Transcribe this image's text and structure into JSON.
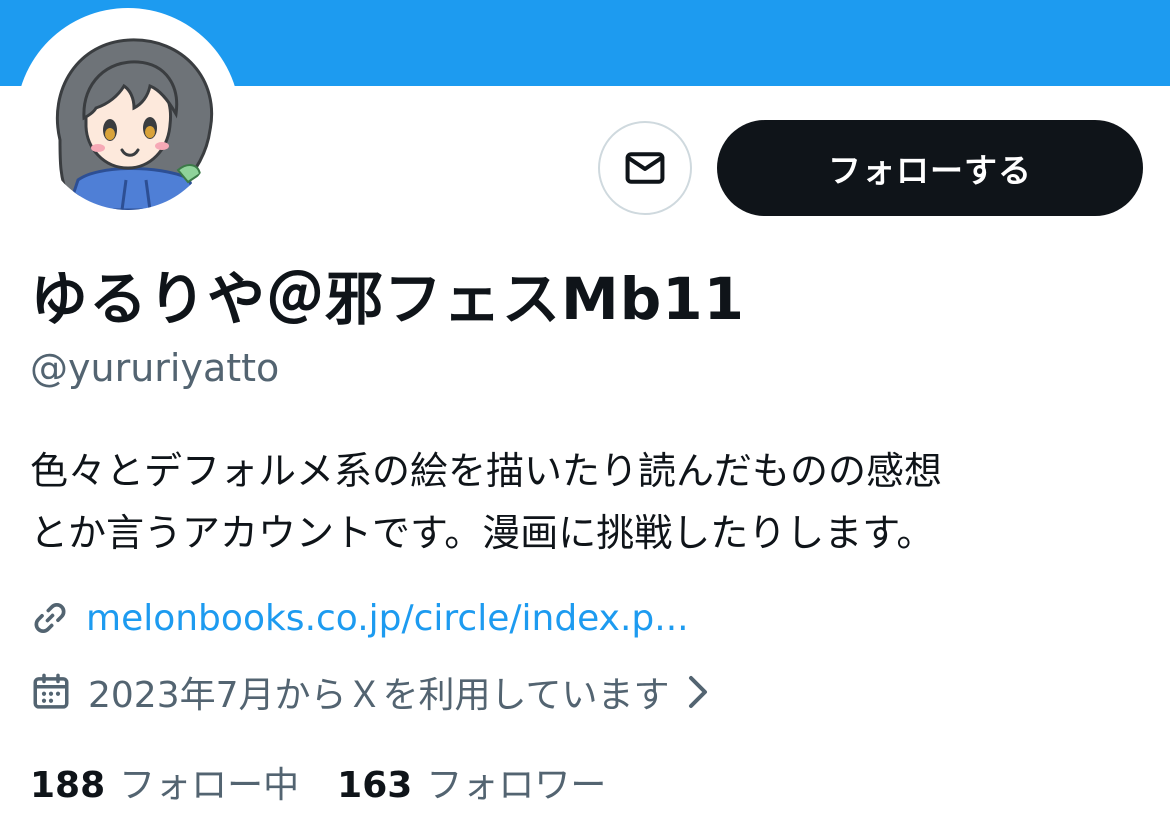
{
  "profile": {
    "display_name": "ゆるりや＠邪フェスMb11",
    "handle": "@yururiyatto",
    "bio_lines": [
      "色々とデフォルメ系の絵を描いたり読んだものの感想",
      "とか言うアカウントです。漫画に挑戦したりします。"
    ],
    "link": "melonbooks.co.jp/circle/index.p...",
    "joined": "2023年7月からＸを利用しています"
  },
  "actions": {
    "follow_label": "フォローする",
    "message_icon": "mail-icon"
  },
  "stats": {
    "following_count": "188",
    "following_label": "フォロー中",
    "followers_count": "163",
    "followers_label": "フォロワー"
  },
  "icons": {
    "link": "link-icon",
    "calendar": "calendar-icon",
    "chevron": "chevron-right-icon"
  },
  "colors": {
    "banner": "#1d9bf0",
    "accent": "#1d9bf0",
    "follow_button_bg": "#0f1419",
    "secondary_text": "#536471",
    "border": "#cfd9de"
  }
}
